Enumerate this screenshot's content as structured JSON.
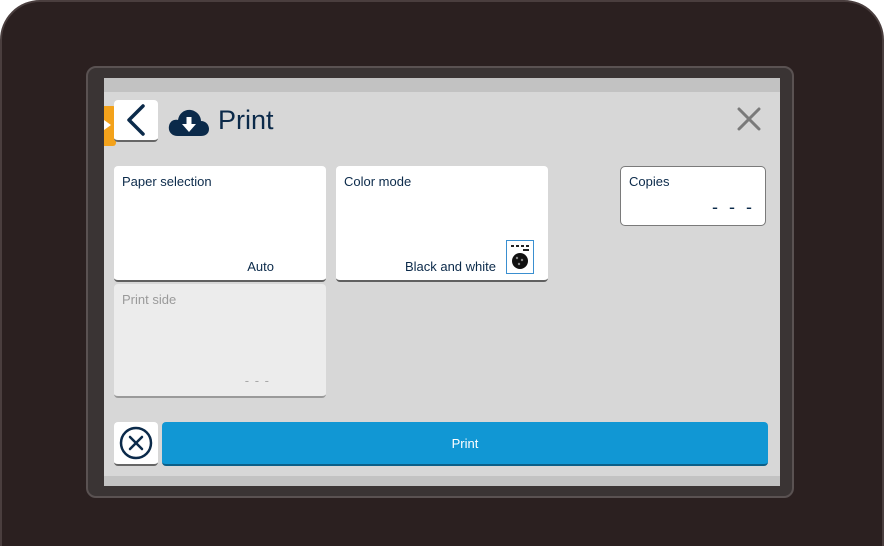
{
  "header": {
    "title": "Print",
    "back_icon": "chevron-left-icon",
    "title_icon": "cloud-download-icon",
    "close_icon": "close-icon"
  },
  "settings": {
    "paper_selection": {
      "label": "Paper selection",
      "value": "Auto"
    },
    "color_mode": {
      "label": "Color mode",
      "value": "Black and white",
      "icon": "black-and-white-icon"
    },
    "copies": {
      "label": "Copies",
      "value": "- - -"
    },
    "print_side": {
      "label": "Print side",
      "value": "- - -",
      "disabled": true
    }
  },
  "footer": {
    "cancel_icon": "cancel-circle-icon",
    "print_label": "Print"
  },
  "colors": {
    "accent": "#1197d4",
    "edge_tab": "#f3a21b",
    "text_primary": "#0b2a4a",
    "screen_bg": "#d7d7d7"
  }
}
